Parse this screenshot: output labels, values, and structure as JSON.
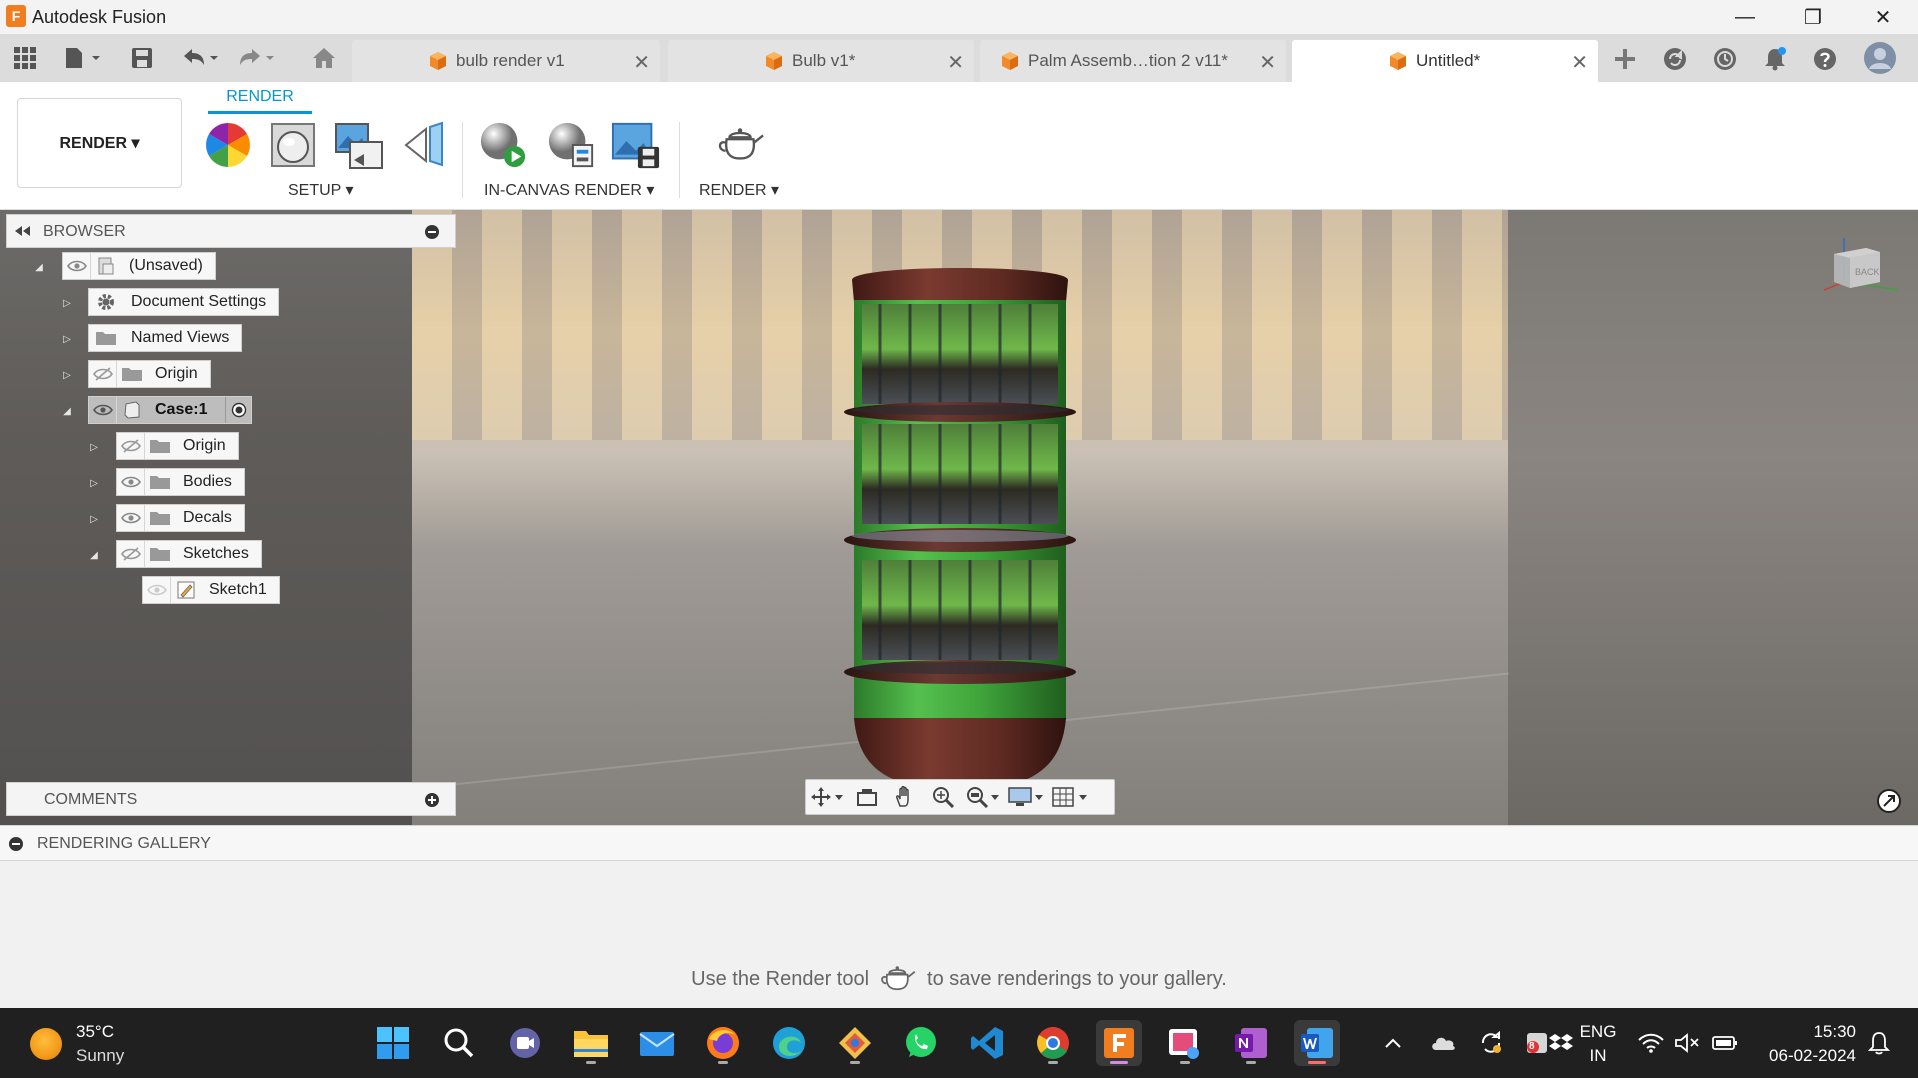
{
  "window": {
    "app_title": "Autodesk Fusion",
    "logo_letter": "F",
    "minimize": "—",
    "maximize": "❐",
    "close": "✕"
  },
  "tabs": [
    {
      "label": "bulb render v1",
      "active": false
    },
    {
      "label": "Bulb v1*",
      "active": false
    },
    {
      "label": "Palm Assemb…tion 2 v11*",
      "active": false
    },
    {
      "label": "Untitled*",
      "active": true
    }
  ],
  "tab_close": "✕",
  "ribbon": {
    "workspace": "RENDER ▾",
    "tab": "RENDER",
    "groups": [
      {
        "label": "SETUP ▾"
      },
      {
        "label": "IN-CANVAS RENDER ▾"
      },
      {
        "label": "RENDER ▾"
      }
    ]
  },
  "browser": {
    "title": "BROWSER",
    "items": [
      {
        "label": "(Unsaved)"
      },
      {
        "label": "Document Settings"
      },
      {
        "label": "Named Views"
      },
      {
        "label": "Origin"
      },
      {
        "label": "Case:1"
      },
      {
        "label": "Origin"
      },
      {
        "label": "Bodies"
      },
      {
        "label": "Decals"
      },
      {
        "label": "Sketches"
      },
      {
        "label": "Sketch1"
      }
    ]
  },
  "comments": {
    "title": "COMMENTS"
  },
  "viewcube": {
    "face_label": "BACK"
  },
  "gallery": {
    "title": "RENDERING GALLERY",
    "hint_before": "Use the Render tool",
    "hint_after": "to save renderings to your gallery."
  },
  "taskbar": {
    "weather_temp": "35°C",
    "weather_cond": "Sunny",
    "lang_line1": "ENG",
    "lang_line2": "IN",
    "time": "15:30",
    "date": "06-02-2024",
    "badge_count": "8"
  },
  "colors": {
    "accent": "#0696d7",
    "fusion_orange": "#f07d1f",
    "model_green": "#3fa43a",
    "model_brown": "#5e2a22"
  }
}
